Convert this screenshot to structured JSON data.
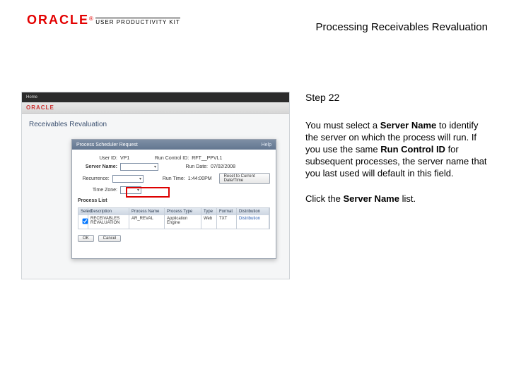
{
  "header": {
    "logo_text": "ORACLE",
    "logo_suffix": "®",
    "subline": "USER PRODUCTIVITY KIT",
    "doc_title": "Processing Receivables Revaluation"
  },
  "instruction": {
    "step_label": "Step 22",
    "body_pre": "You must select a ",
    "body_bold1": "Server Name",
    "body_mid1": " to identify the server on which the process will run. If you use the same ",
    "body_bold2": "Run Control ID",
    "body_mid2": " for subsequent processes, the server name that you last used will default in this field.",
    "action_pre": "Click the ",
    "action_bold": "Server Name",
    "action_post": " list."
  },
  "screenshot": {
    "brand": "ORACLE",
    "page_title": "Receivables Revaluation",
    "nav_home": "Home",
    "modal": {
      "title": "Process Scheduler Request",
      "help": "Help",
      "user_label": "User ID:",
      "user_value": "VP1",
      "runctl_label": "Run Control ID:",
      "runctl_value": "RFT__PPVL1",
      "server_label": "Server Name:",
      "server_value": "",
      "recur_label": "Recurrence:",
      "recur_value": "",
      "tz_label": "Time Zone:",
      "tz_value": "",
      "rundate_label": "Run Date:",
      "rundate_value": "07/02/2008",
      "runtime_label": "Run Time:",
      "runtime_value": "1:44:00PM",
      "reset_btn": "Reset to Current Date/Time",
      "list_head": "Process List",
      "cols": {
        "sel": "Select",
        "desc": "Description",
        "pname": "Process Name",
        "ptype": "Process Type",
        "type": "Type",
        "format": "Format",
        "dist": "Distribution"
      },
      "row": {
        "desc": "RECEIVABLES REVALUATION",
        "pname": "AR_REVAL",
        "ptype": "Application Engine",
        "type": "Web",
        "format": "TXT",
        "dist": "Distribution"
      },
      "ok": "OK",
      "cancel": "Cancel"
    }
  }
}
